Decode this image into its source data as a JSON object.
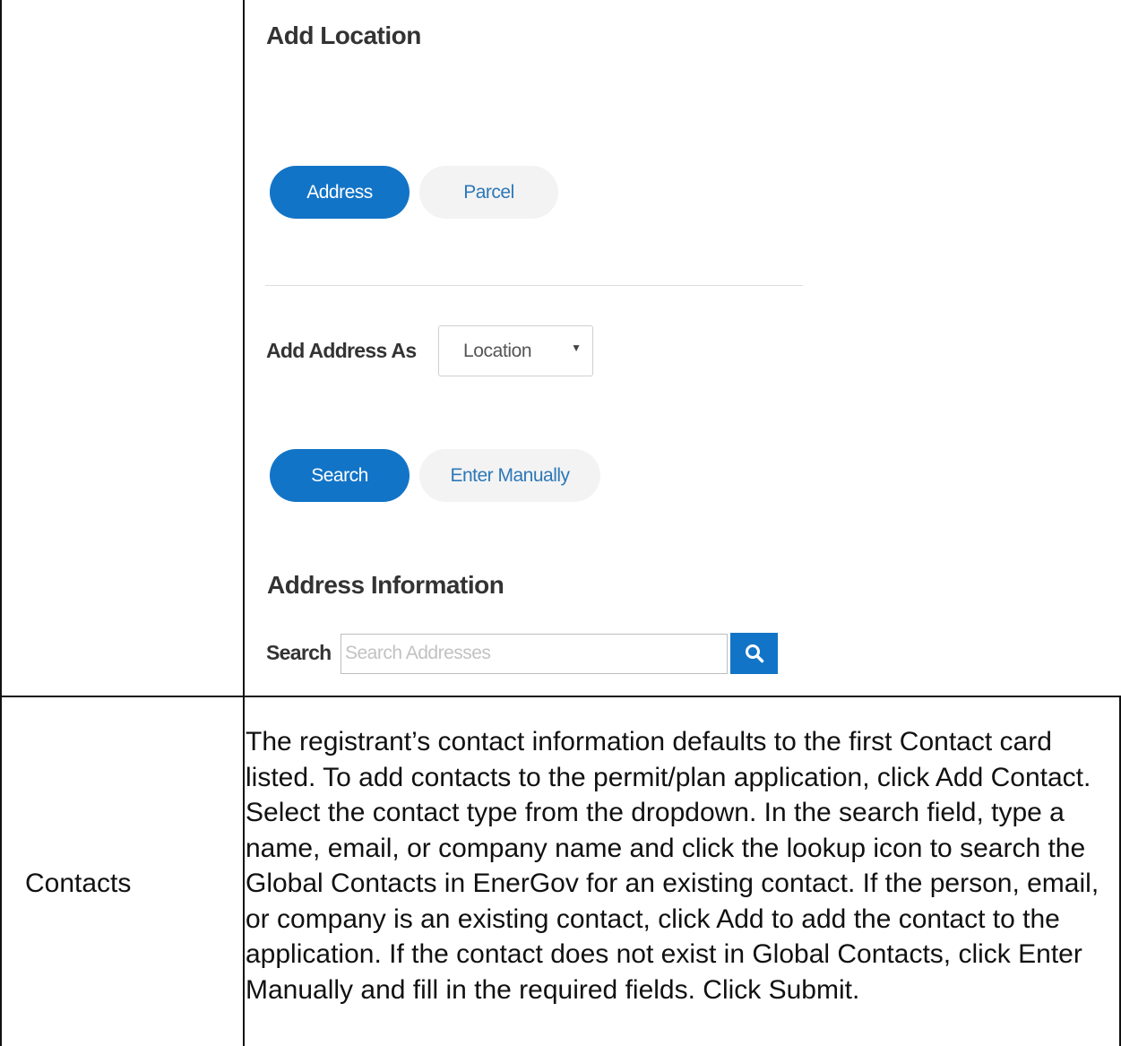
{
  "add_location": {
    "title": "Add Location",
    "tabs": [
      {
        "label": "Address",
        "selected": true
      },
      {
        "label": "Parcel",
        "selected": false
      }
    ],
    "add_address_as": {
      "label": "Add Address As",
      "selected_value": "Location"
    },
    "mode_buttons": [
      {
        "label": "Search",
        "selected": true
      },
      {
        "label": "Enter Manually",
        "selected": false
      }
    ],
    "address_information": {
      "title": "Address Information",
      "search_label": "Search",
      "search_placeholder": "Search Addresses"
    },
    "icons": {
      "search_button_icon": "search-icon",
      "select_caret_icon": "caret-down-icon"
    },
    "colors": {
      "primary": "#1274c7",
      "secondary_bg": "#f3f3f3",
      "secondary_text": "#2d78b8"
    }
  },
  "contacts_row": {
    "label": "Contacts",
    "description": "The registrant’s contact information defaults to the first Contact card listed. To add contacts to the permit/plan application, click Add Contact. Select the contact type from the dropdown. In the search field, type a name, email, or company name and click the lookup icon to search the Global Contacts in EnerGov for an existing contact. If the person, email, or company is an existing contact, click Add to add the contact to the application. If the contact does not exist in Global Contacts, click Enter Manually and fill in the required fields. Click Submit."
  }
}
